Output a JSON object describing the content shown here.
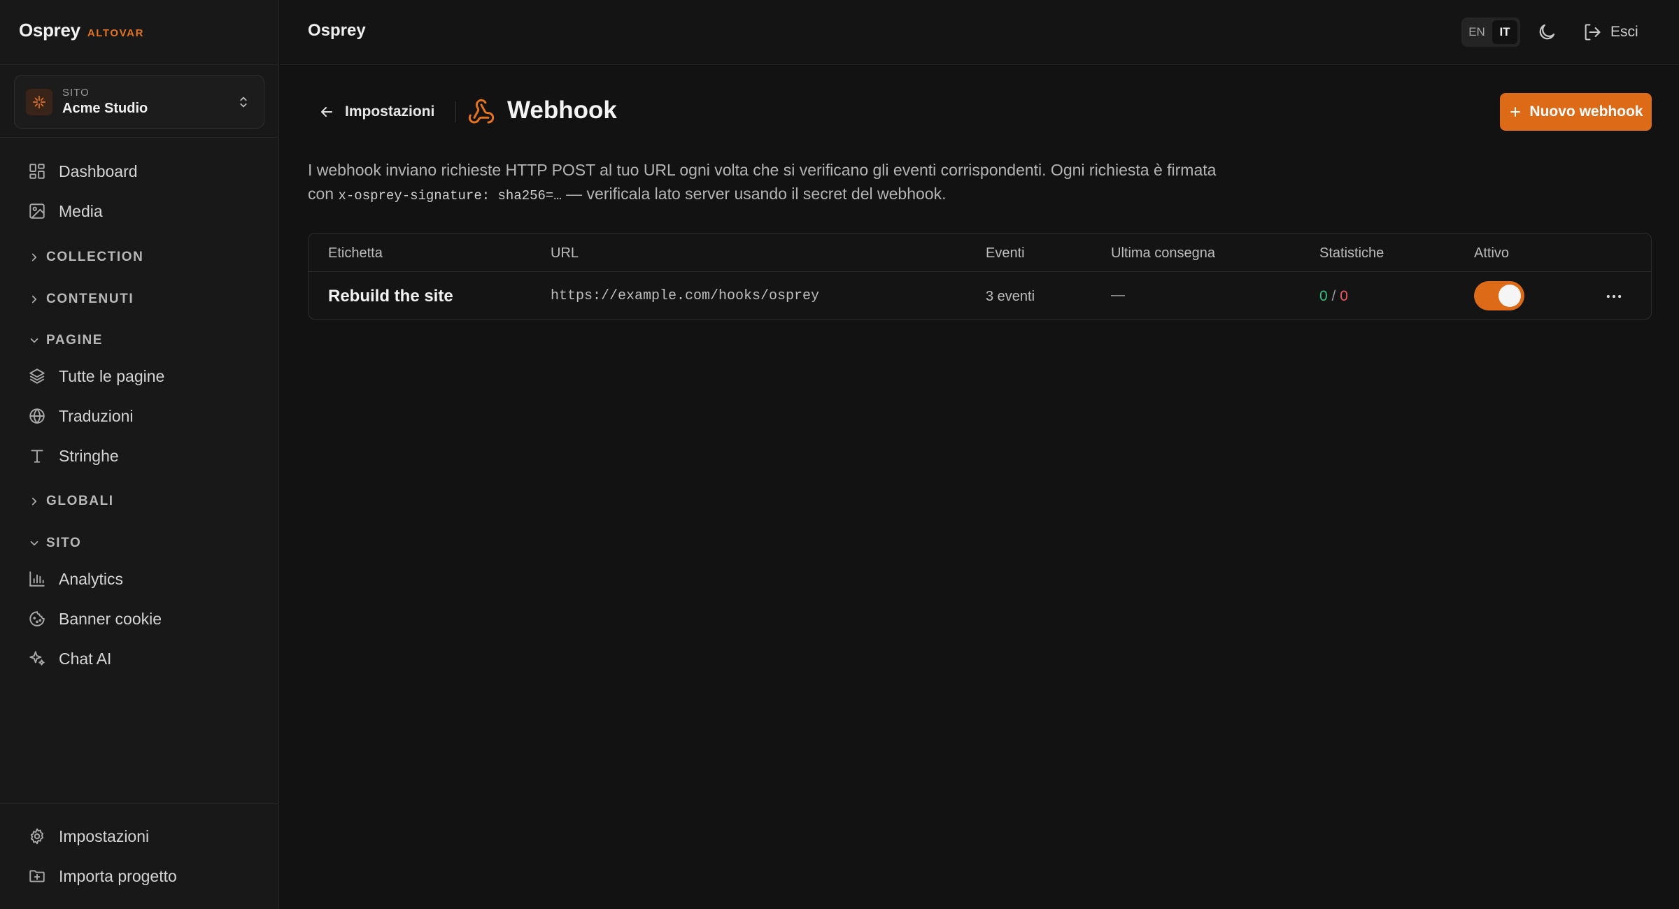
{
  "brand": {
    "name": "Osprey",
    "tag": "ALTOVAR"
  },
  "site_switcher": {
    "kicker": "SITO",
    "name": "Acme Studio"
  },
  "sidebar": {
    "dashboard": "Dashboard",
    "media": "Media",
    "collection": "COLLECTION",
    "contenuti": "CONTENUTI",
    "pagine": "PAGINE",
    "tutte_le_pagine": "Tutte le pagine",
    "traduzioni": "Traduzioni",
    "stringhe": "Stringhe",
    "globali": "GLOBALI",
    "sito": "SITO",
    "analytics": "Analytics",
    "banner_cookie": "Banner cookie",
    "chat_ai": "Chat AI",
    "impostazioni": "Impostazioni",
    "importa_progetto": "Importa progetto"
  },
  "topbar": {
    "title": "Osprey",
    "lang_en": "EN",
    "lang_it": "IT",
    "logout": "Esci"
  },
  "header": {
    "back": "Impostazioni",
    "title": "Webhook",
    "new_button": "Nuovo webhook"
  },
  "description": {
    "part1": "I webhook inviano richieste HTTP POST al tuo URL ogni volta che si verificano gli eventi corrispondenti. Ogni richiesta è firmata con ",
    "code": "x-osprey-signature: sha256=…",
    "part2": " — verificala lato server usando il secret del webhook."
  },
  "table": {
    "columns": {
      "label": "Etichetta",
      "url": "URL",
      "events": "Eventi",
      "last_delivery": "Ultima consegna",
      "stats": "Statistiche",
      "active": "Attivo"
    },
    "rows": [
      {
        "label": "Rebuild the site",
        "url": "https://example.com/hooks/osprey",
        "events": "3 eventi",
        "last_delivery": "—",
        "stats_ok": "0",
        "stats_sep": "/",
        "stats_fail": "0",
        "active": true
      }
    ]
  },
  "colors": {
    "accent": "#dd6a17",
    "success": "#35c27e",
    "error": "#ef5a5a"
  }
}
